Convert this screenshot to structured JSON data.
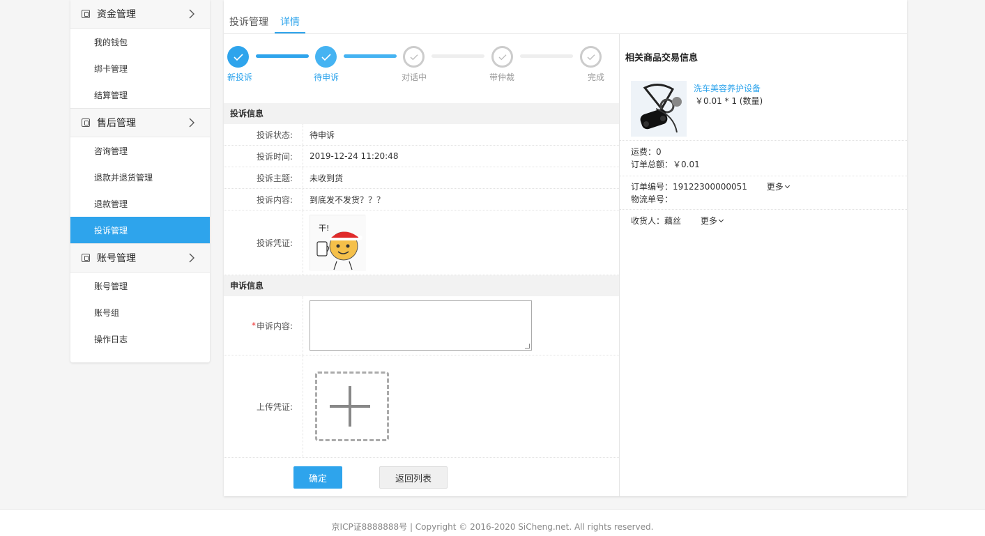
{
  "sidebar": {
    "groups": [
      {
        "title": "资金管理",
        "items": [
          "我的钱包",
          "绑卡管理",
          "结算管理"
        ]
      },
      {
        "title": "售后管理",
        "items": [
          "咨询管理",
          "退款并退货管理",
          "退款管理",
          "投诉管理"
        ]
      },
      {
        "title": "账号管理",
        "items": [
          "账号管理",
          "账号组",
          "操作日志"
        ]
      }
    ],
    "active_item": "投诉管理"
  },
  "tabs": {
    "list": "投诉管理",
    "detail": "详情"
  },
  "steps": [
    {
      "label": "新投诉",
      "state": "done"
    },
    {
      "label": "待申诉",
      "state": "current"
    },
    {
      "label": "对话中",
      "state": "todo"
    },
    {
      "label": "带仲裁",
      "state": "todo"
    },
    {
      "label": "完成",
      "state": "todo"
    }
  ],
  "complaint": {
    "section_title": "投诉信息",
    "status_label": "投诉状态:",
    "status": "待申诉",
    "time_label": "投诉时间:",
    "time": "2019-12-24 11:20:48",
    "subject_label": "投诉主题:",
    "subject": "未收到货",
    "content_label": "投诉内容:",
    "content": "到底发不发货？？？",
    "evidence_label": "投诉凭证:",
    "evidence_image_text": "干!"
  },
  "appeal": {
    "section_title": "申诉信息",
    "required_mark": "*",
    "content_label": "申诉内容:",
    "content_value": "",
    "upload_label": "上传凭证:"
  },
  "buttons": {
    "ok": "确定",
    "back": "返回列表"
  },
  "order": {
    "title": "相关商品交易信息",
    "product_name": "洗车美容养护设备",
    "product_price": "￥0.01 * 1 (数量)",
    "shipping": "运费：0",
    "total": "订单总额：￥0.01",
    "order_no": "订单编号：19122300000051",
    "logistics": "物流单号：",
    "receiver": "收货人：藕丝",
    "more": "更多"
  },
  "footer": {
    "text": "京ICP证8888888号 | Copyright © 2016-2020 SiCheng.net. All rights reserved."
  },
  "colors": {
    "accent": "#2ea4ec",
    "current_step": "#45b3f2",
    "inactive": "#cccccc"
  }
}
